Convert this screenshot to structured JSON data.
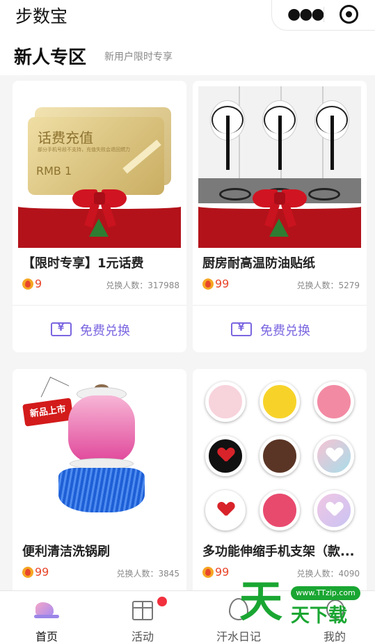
{
  "app": {
    "title": "步数宝"
  },
  "capsule": {
    "more_icon": "more-dots-icon",
    "close_icon": "target-close-icon"
  },
  "section": {
    "title": "新人专区",
    "subtitle": "新用户限时专享"
  },
  "products": [
    {
      "title": "【限时专享】1元话费",
      "price": "9",
      "swap_count": "兑换人数：317988",
      "redeem_label": "免费兑换",
      "image": {
        "card_title": "话费充值",
        "card_fine_print": "部分手机号段不支持，充值失败会退回燃力",
        "card_value": "RMB 1"
      }
    },
    {
      "title": "厨房耐高温防油贴纸",
      "price": "99",
      "swap_count": "兑换人数：5279",
      "redeem_label": "免费兑换"
    },
    {
      "title": "便利清洁洗锅刷",
      "price": "99",
      "swap_count": "兑换人数：3845",
      "image": {
        "tag": "新品上市"
      }
    },
    {
      "title": "多功能伸缩手机支架（款...",
      "price": "99",
      "swap_count": "兑换人数：4090"
    }
  ],
  "tabs": [
    {
      "label": "首页",
      "icon": "sneaker-icon",
      "active": true
    },
    {
      "label": "活动",
      "icon": "gift-icon",
      "badge": true
    },
    {
      "label": "汗水日记",
      "icon": "sweat-drop-icon"
    },
    {
      "label": "我的",
      "icon": "profile-icon"
    }
  ],
  "watermark": {
    "big": "天",
    "small": "天下载",
    "url": "www.TTzip.com"
  },
  "colors": {
    "accent": "#7b66e0",
    "price": "#e8462b",
    "badge": "#f2303e",
    "watermark": "#1aa632"
  }
}
